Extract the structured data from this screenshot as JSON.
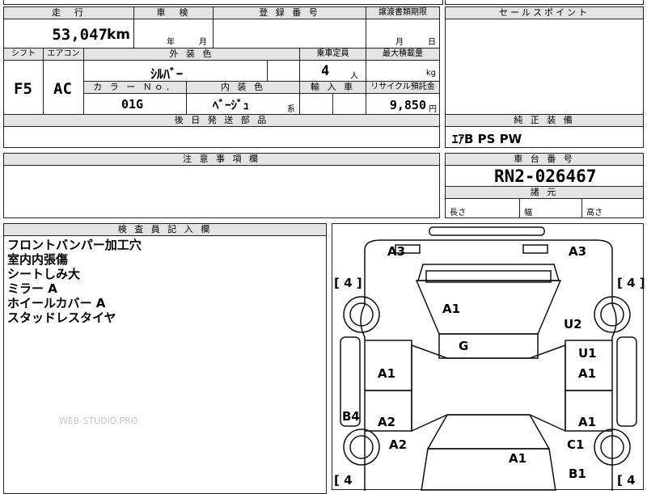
{
  "header_labels": {
    "mileage": "走　行",
    "inspection": "車　検",
    "registration": "登 録 番 号",
    "transfer_deadline": "譲渡書類期限",
    "sales_point": "セールスポイント",
    "shift": "シフト",
    "aircon": "エアコン",
    "exterior_color": "外 装 色",
    "capacity": "乗車定員",
    "max_load": "最大積載量",
    "color_no": "カ ラ ー Ｎｏ．",
    "interior_color": "内 装 色",
    "import": "輸 入 車",
    "recycle_fee": "リサイクル預託金",
    "later_parts": "後 日 発 送 部 品",
    "factory_equipment": "純 正 装 備",
    "notes": "注 意 事 項 欄",
    "chassis_number": "車 台 番 号",
    "dimensions": "諸 元",
    "inspector_notes": "検 査 員 記 入 欄"
  },
  "values": {
    "mileage": "53,047",
    "mileage_unit": "km",
    "inspection_year_unit": "年",
    "inspection_month_unit": "月",
    "deadline_month_unit": "月",
    "deadline_day_unit": "日",
    "shift": "F5",
    "aircon": "AC",
    "exterior_color": "ｼﾙﾊﾞｰ",
    "capacity": "4",
    "capacity_unit": "人",
    "load_unit": "kg",
    "color_no": "01G",
    "interior_color": "ﾍﾞｰｼﾞｭ",
    "interior_suffix": "系",
    "recycle_fee": "9,850",
    "recycle_unit": "円",
    "factory_equipment": "ｴｱB  PS  PW",
    "chassis_number": "RN2-026467",
    "length_label": "長さ",
    "width_label": "幅",
    "height_label": "高さ"
  },
  "inspector_remarks": [
    "フロントバンパー加工穴",
    "室内内張傷",
    "シートしみ大",
    "ミラー A",
    "ホイールカバー A",
    "スタッドレスタイヤ"
  ],
  "watermark": "WEB-STUDIO.PRO",
  "diagram_marks": {
    "front_left": "A3",
    "front_right": "A3",
    "hood": "A1",
    "right_front_fender": "U2",
    "roof": "G",
    "right_front_door": "U1",
    "right_front_door_lower": "A1",
    "left_front_door": "A1",
    "left_pillar": "B4",
    "left_rear_door": "A2",
    "right_rear_door": "A1",
    "left_rear_fender": "A2",
    "right_rear_fender": "C1",
    "trunk": "A1",
    "rear_right": "B1",
    "tire_front_left": "[ 4 ]",
    "tire_front_right": "[ 4 ]",
    "tire_rear_left": "[ 4",
    "tire_rear_right": "[ 4"
  }
}
